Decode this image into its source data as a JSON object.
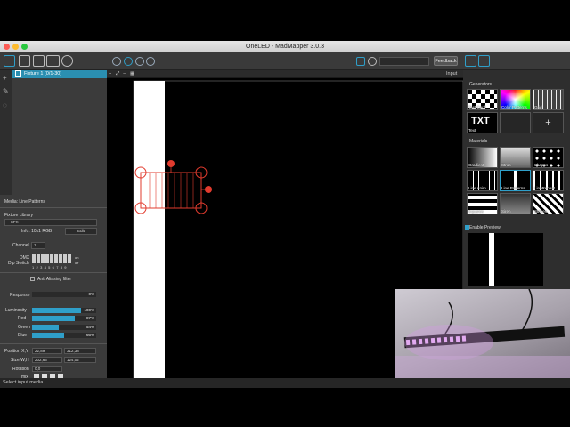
{
  "window": {
    "title": "OneLED - MadMapper 3.0.3",
    "feedback_label": "Feedback"
  },
  "fixture_list": {
    "selected_item": "Fixture 1 (0/1-30)"
  },
  "canvas": {
    "input_label": "Input"
  },
  "properties": {
    "media_line": "Media: Line Patterns",
    "fixture_library_label": "Fixture Library",
    "fixture_library_value": "~ SFX",
    "info_text": "Info: 10x1 RGB",
    "edit_label": "Edit",
    "channel_label": "Channel",
    "channel_value": "1",
    "dmx_label": "DMX",
    "dip_switch_label": "Dip Switch",
    "dip_on": "on",
    "dip_off": "off",
    "dip_numbers": "1 2 3 4 5 6 7 8 9",
    "anti_aliasing_label": "Anti Aliasing filter",
    "response_label": "Response",
    "response_value": "0%",
    "response_level": 0,
    "sliders": [
      {
        "label": "Luminosity",
        "value": "100%",
        "level": 100
      },
      {
        "label": "Red",
        "value": "87%",
        "level": 87
      },
      {
        "label": "Green",
        "value": "54%",
        "level": 54
      },
      {
        "label": "Blue",
        "value": "66%",
        "level": 66
      }
    ],
    "position_label": "Position X,Y",
    "position_x": "22,89",
    "position_y": "312,38",
    "size_label": "Size W,H",
    "size_w": "202,63",
    "size_h": "124,02",
    "rotation_label": "Rotation",
    "rotation_value": "0,0",
    "mix_label": "mix"
  },
  "right_panel": {
    "generators_label": "Generators",
    "generators": [
      {
        "label": "Test Card"
      },
      {
        "label": "Color Patterns"
      },
      {
        "label": "Grid"
      },
      {
        "label": "Text"
      }
    ],
    "generators_add": "+",
    "text_tile_glyph": "TXT",
    "materials_label": "Materials",
    "materials": [
      {
        "label": "Gradient"
      },
      {
        "label": "Strob"
      },
      {
        "label": "Shapes"
      },
      {
        "label": "Line Anim"
      },
      {
        "label": "Line Patterns"
      },
      {
        "label": "LineRepeat"
      },
      {
        "label": "Squares"
      },
      {
        "label": "Siren"
      },
      {
        "label": "Stripes"
      }
    ],
    "preview_label": "Enable Preview"
  },
  "status_bar": {
    "text": "Select input media"
  },
  "colors": {
    "accent": "#2f9fc9",
    "handle": "#e23b2e",
    "background": "#000000"
  }
}
